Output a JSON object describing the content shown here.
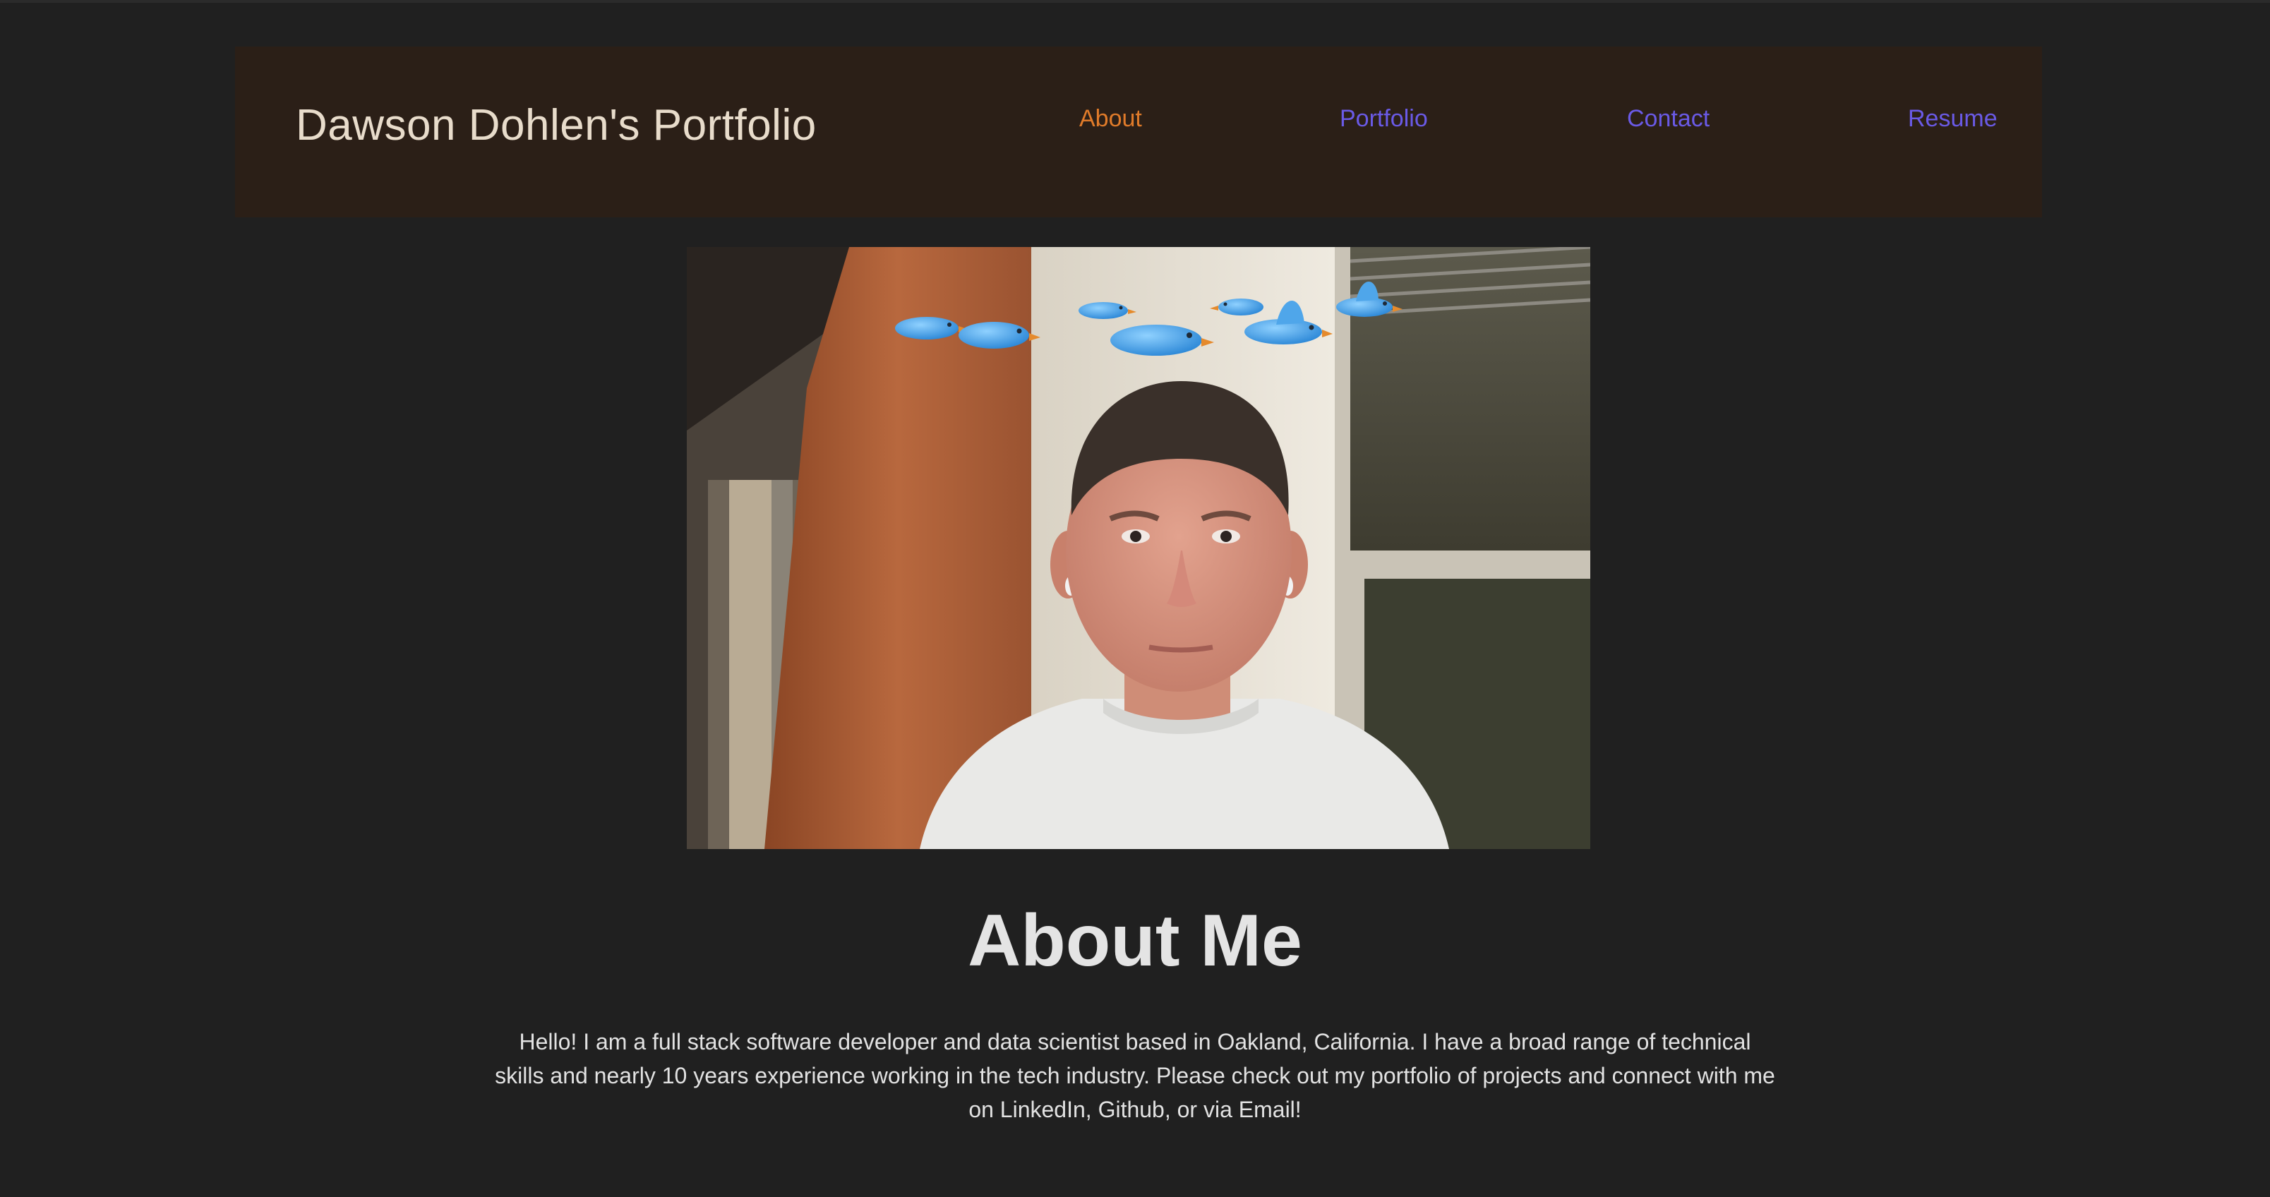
{
  "header": {
    "title": "Dawson Dohlen's Portfolio",
    "nav": [
      {
        "label": "About",
        "color": "#e07b2a"
      },
      {
        "label": "Portfolio",
        "color": "#6a5ae6"
      },
      {
        "label": "Contact",
        "color": "#6a5ae6"
      },
      {
        "label": "Resume",
        "color": "#6a5ae6"
      }
    ]
  },
  "hero": {
    "image": "portrait-photo-with-cartoon-bluebirds"
  },
  "about": {
    "heading": "About Me",
    "text": "Hello! I am a full stack software developer and data scientist based in Oakland, California. I have a broad range of technical skills and nearly 10 years experience working in the tech industry. Please check out my portfolio of projects and connect with me on LinkedIn, Github, or via Email!"
  },
  "colors": {
    "page_background": "#202020",
    "header_background": "#2b1f17",
    "title_text": "#e8dccb",
    "accent_active": "#e07b2a",
    "accent_link": "#6a5ae6"
  }
}
